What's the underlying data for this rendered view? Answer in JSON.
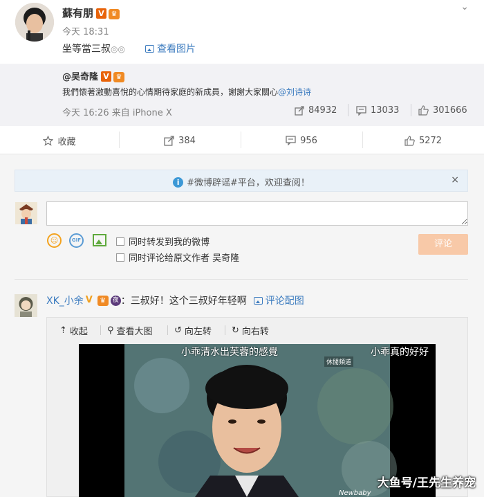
{
  "post": {
    "author": "蘇有朋",
    "time": "今天 18:31",
    "content": "坐等當三叔",
    "view_pic": "查看图片",
    "more_icon": "chevron-down-icon"
  },
  "repost": {
    "author": "@吴奇隆",
    "text": "我們懷著激動喜悅的心情期待家庭的新成員，謝謝大家關心",
    "mention": "@刘诗诗",
    "time": "今天 16:26 来自 iPhone X",
    "reposts": "84932",
    "comments": "13033",
    "likes": "301666"
  },
  "actions": {
    "favorite": "收藏",
    "forward": "384",
    "comment": "956",
    "like": "5272"
  },
  "notice": {
    "text": "#微博辟谣#平台，欢迎查阅！",
    "close": "×"
  },
  "composer": {
    "placeholder": "",
    "option1": "同时转发到我的微博",
    "option2": "同时评论给原文作者 吴奇隆",
    "submit": "评论",
    "gif": "GIF"
  },
  "comment": {
    "user": "XK_小余",
    "text": "：三叔好！这个三叔好年轻啊",
    "link": "评论配图"
  },
  "media": {
    "collapse": "收起",
    "view_large": "查看大图",
    "rotate_left": "向左转",
    "rotate_right": "向右转",
    "subtitle1": "小乖清水出芙蓉的感覺",
    "subtitle2": "小乖真的好好",
    "channel": "休閒頻道",
    "tag": "Newbaby",
    "watermark": "大鱼号/王先生养宠"
  },
  "colors": {
    "link": "#3b7bbf",
    "submit_bg": "#f8c9a8",
    "notice_bg": "#e9f1f8"
  }
}
